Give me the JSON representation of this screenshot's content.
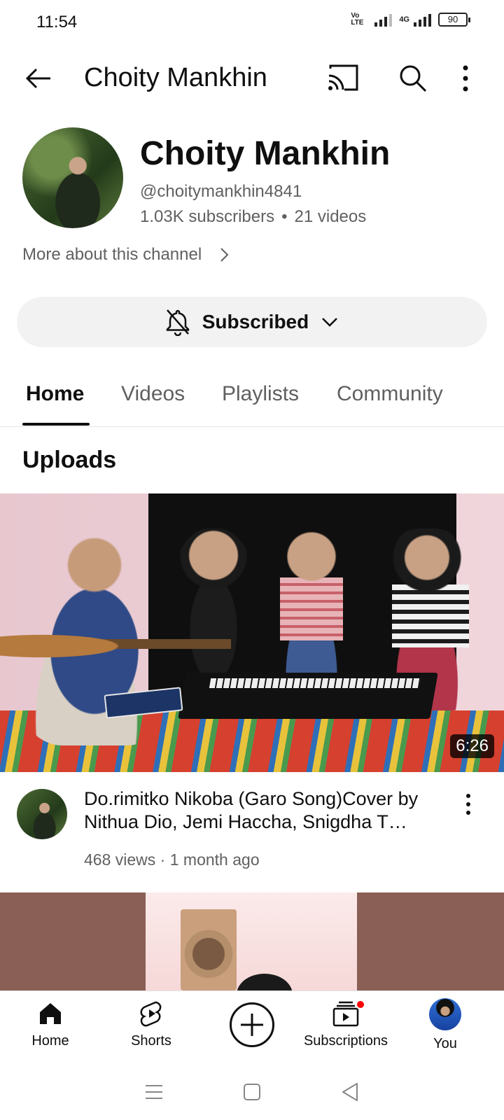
{
  "status_bar": {
    "time": "11:54",
    "volte": "Vo LTE",
    "network": "4G",
    "battery": "90"
  },
  "app_bar": {
    "title": "Choity Mankhin",
    "icons": [
      "back-arrow-icon",
      "cast-icon",
      "search-icon",
      "more-vert-icon"
    ]
  },
  "channel": {
    "name": "Choity Mankhin",
    "handle": "@choitymankhin4841",
    "subscribers": "1.03K subscribers",
    "separator": "•",
    "videos": "21 videos",
    "more_about": "More about this channel",
    "subscribe_button": "Subscribed"
  },
  "tabs": [
    {
      "label": "Home",
      "active": true
    },
    {
      "label": "Videos",
      "active": false
    },
    {
      "label": "Playlists",
      "active": false
    },
    {
      "label": "Community",
      "active": false
    }
  ],
  "uploads": {
    "section_title": "Uploads",
    "videos": [
      {
        "title": "Do.rimitko Nikoba (Garo Song)Cover by Nithua Dio, Jemi Haccha, Snigdha T…",
        "views": "468 views",
        "separator": "·",
        "age": "1 month ago",
        "duration": "6:26"
      }
    ]
  },
  "bottom_nav": [
    {
      "label": "Home",
      "icon": "home-icon"
    },
    {
      "label": "Shorts",
      "icon": "shorts-icon"
    },
    {
      "label": "",
      "icon": "create-plus-icon"
    },
    {
      "label": "Subscriptions",
      "icon": "subscriptions-icon",
      "badge": true
    },
    {
      "label": "You",
      "icon": "avatar"
    }
  ],
  "colors": {
    "primary_text": "#0f0f0f",
    "secondary_text": "#606060",
    "button_bg": "#f2f2f2",
    "badge": "#ff0000"
  }
}
